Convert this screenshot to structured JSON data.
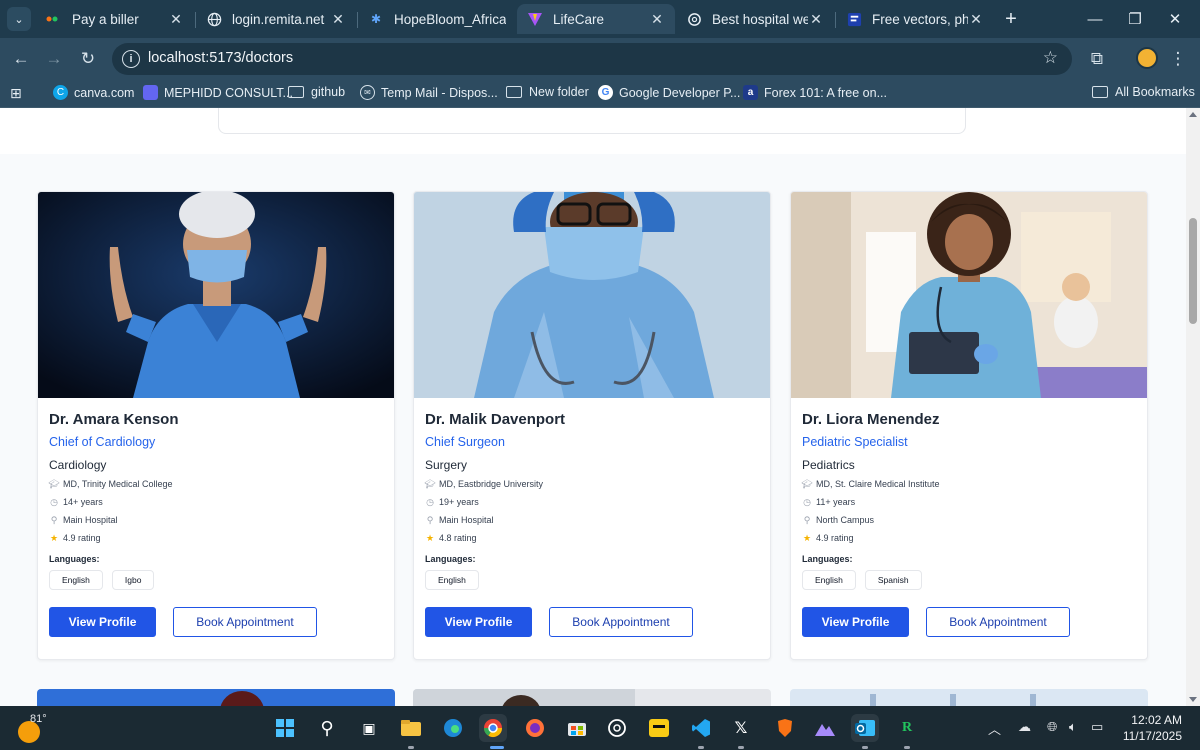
{
  "browser": {
    "tabs": [
      {
        "title": "Pay a biller",
        "favicon": "dots-icon",
        "active": false
      },
      {
        "title": "login.remita.net",
        "favicon": "globe-icon",
        "active": false
      },
      {
        "title": "HopeBloom_Africa",
        "favicon": "react-icon",
        "active": false
      },
      {
        "title": "LifeCare",
        "favicon": "vite-icon",
        "active": true
      },
      {
        "title": "Best hospital webs",
        "favicon": "openai-icon",
        "active": false
      },
      {
        "title": "Free vectors, photo",
        "favicon": "freepik-icon",
        "active": false
      }
    ],
    "close_glyph": "✕",
    "new_tab_glyph": "+",
    "url": "localhost:5173/doctors",
    "bookmarks": [
      {
        "label": "canva.com",
        "icon": "canva-icon"
      },
      {
        "label": "MEPHIDD CONSULT...",
        "icon": "page-icon"
      },
      {
        "label": "github",
        "icon": "folder-icon"
      },
      {
        "label": "Temp Mail - Dispos...",
        "icon": "tempmail-icon"
      },
      {
        "label": "New folder",
        "icon": "folder-icon"
      },
      {
        "label": "Google Developer P...",
        "icon": "google-icon"
      },
      {
        "label": "Forex 101: A free on...",
        "icon": "forex-icon"
      }
    ],
    "all_bookmarks": "All Bookmarks"
  },
  "doctors": [
    {
      "name": "Dr. Amara Kenson",
      "title": "Chief of Cardiology",
      "department": "Cardiology",
      "education": "MD, Trinity Medical College",
      "experience": "14+ years",
      "location": "Main Hospital",
      "rating": "4.9 rating",
      "languages_label": "Languages:",
      "languages": [
        "English",
        "Igbo"
      ],
      "view_label": "View Profile",
      "book_label": "Book Appointment"
    },
    {
      "name": "Dr. Malik Davenport",
      "title": "Chief Surgeon",
      "department": "Surgery",
      "education": "MD, Eastbridge University",
      "experience": "19+ years",
      "location": "Main Hospital",
      "rating": "4.8 rating",
      "languages_label": "Languages:",
      "languages": [
        "English"
      ],
      "view_label": "View Profile",
      "book_label": "Book Appointment"
    },
    {
      "name": "Dr. Liora Menendez",
      "title": "Pediatric Specialist",
      "department": "Pediatrics",
      "education": "MD, St. Claire Medical Institute",
      "experience": "11+ years",
      "location": "North Campus",
      "rating": "4.9 rating",
      "languages_label": "Languages:",
      "languages": [
        "English",
        "Spanish"
      ],
      "view_label": "View Profile",
      "book_label": "Book Appointment"
    }
  ],
  "taskbar": {
    "temperature": "81°",
    "time": "12:02 AM",
    "date": "11/17/2025"
  },
  "colors": {
    "accent": "#2155e6",
    "title_blue": "#2563eb",
    "chrome_dark": "#1f3b4d",
    "chrome_toolbar": "#2d4b60"
  }
}
